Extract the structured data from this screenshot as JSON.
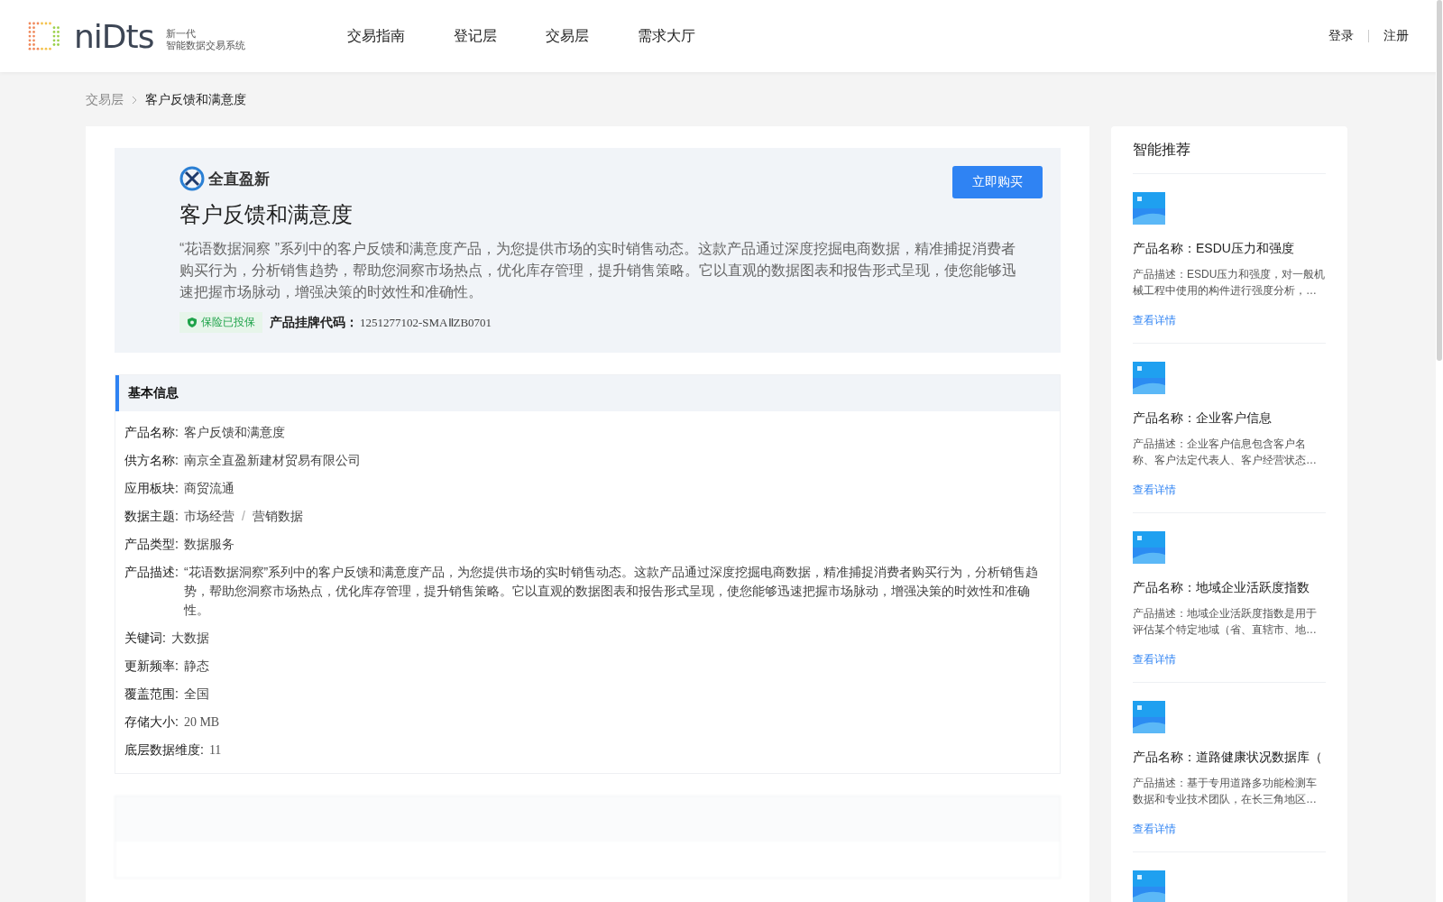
{
  "header": {
    "logo": {
      "wordmark": "niDts",
      "tagline_1": "新一代",
      "tagline_2": "智能数据交易系统"
    },
    "nav": [
      {
        "label": "交易指南",
        "selected": false
      },
      {
        "label": "登记层",
        "selected": false
      },
      {
        "label": "交易层",
        "selected": false
      },
      {
        "label": "需求大厅",
        "selected": false
      }
    ],
    "auth": [
      "登录",
      "注册"
    ]
  },
  "breadcrumb": [
    {
      "label": "交易层",
      "selected": false
    },
    {
      "label": "客户反馈和满意度",
      "selected": true
    }
  ],
  "product": {
    "company_logo": "全直盈新",
    "title": "客户反馈和满意度",
    "buy_button": "立即购买",
    "description": "“花语数据洞察 ”系列中的客户反馈和满意度产品，为您提供市场的实时销售动态。这款产品通过深度挖掘电商数据，精准捕捉消费者购买行为，分析销售趋势，帮助您洞察市场热点，优化库存管理，提升销售策略。它以直观的数据图表和报告形式呈现，使您能够迅速把握市场脉动，增强决策的时效性和准确性。",
    "insurance_badge": "保险已投保",
    "code_label": "产品挂牌代码：",
    "code": "1251277102-SMAⅡZB0701"
  },
  "basic_info": {
    "title": "基本信息",
    "fields": [
      {
        "kind": "text",
        "label": "产品名称:",
        "value": "客户反馈和满意度"
      },
      {
        "kind": "text",
        "label": "供方名称:",
        "value": "南京全直盈新建材贸易有限公司"
      },
      {
        "kind": "text",
        "label": "应用板块:",
        "value": "商贸流通"
      },
      {
        "kind": "path",
        "label": "数据主题:",
        "parts": [
          "市场经营",
          "营销数据"
        ],
        "separator": "/"
      },
      {
        "kind": "text",
        "label": "产品类型:",
        "value": "数据服务"
      },
      {
        "kind": "text",
        "label": "产品描述:",
        "value": "“花语数据洞察”系列中的客户反馈和满意度产品，为您提供市场的实时销售动态。这款产品通过深度挖掘电商数据，精准捕捉消费者购买行为，分析销售趋势，帮助您洞察市场热点，优化库存管理，提升销售策略。它以直观的数据图表和报告形式呈现，使您能够迅速把握市场脉动，增强决策的时效性和准确性。"
      },
      {
        "kind": "text",
        "label": "关键词:",
        "value": "大数据"
      },
      {
        "kind": "text",
        "label": "更新频率:",
        "value": "静态"
      },
      {
        "kind": "text",
        "label": "覆盖范围:",
        "value": "全国"
      },
      {
        "kind": "mono",
        "label": "存储大小:",
        "value": "20 MB"
      },
      {
        "kind": "mono",
        "label": "底层数据维度:",
        "value": "11"
      }
    ]
  },
  "recommendations": {
    "title": "智能推荐",
    "items": [
      {
        "kind": "product",
        "name": "产品名称：ESDU压力和强度",
        "description": "产品描述：ESDU压力和强度，对一般机械工程中使用的构件进行强度分析，…",
        "link": "查看详情"
      },
      {
        "kind": "product",
        "name": "产品名称：企业客户信息",
        "description": "产品描述：企业客户信息包含客户名称、客户法定代表人、客户经营状态…",
        "link": "查看详情"
      },
      {
        "kind": "product",
        "name": "产品名称：地域企业活跃度指数",
        "description": "产品描述：地域企业活跃度指数是用于评估某个特定地域（省、直辖市、地…",
        "link": "查看详情"
      },
      {
        "kind": "product",
        "name": "产品名称：道路健康状况数据库（",
        "description": "产品描述：基于专用道路多功能检测车数据和专业技术团队，在长三角地区…",
        "link": "查看详情"
      },
      {
        "kind": "picture"
      }
    ]
  }
}
